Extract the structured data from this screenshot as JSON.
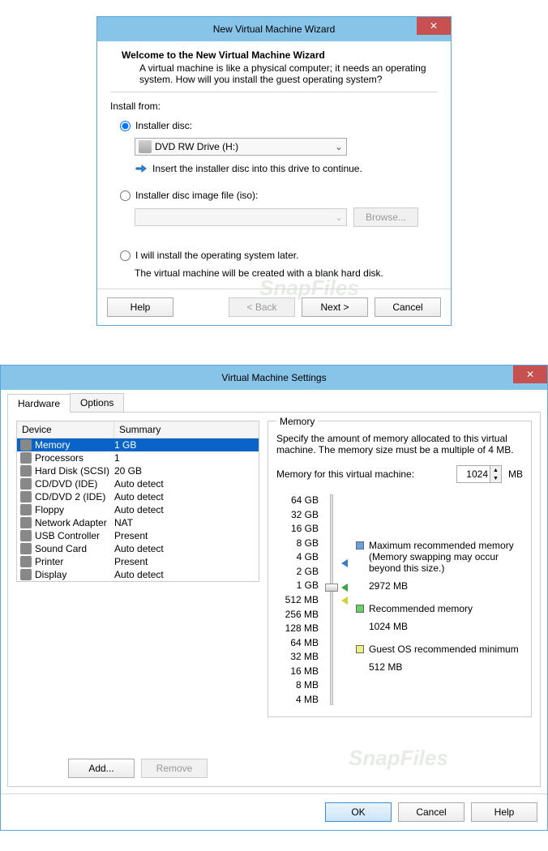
{
  "wizard": {
    "title": "New Virtual Machine Wizard",
    "heading": "Welcome to the New Virtual Machine Wizard",
    "description": "A virtual machine is like a physical computer; it needs an operating system. How will you install the guest operating system?",
    "install_from_label": "Install from:",
    "radio_disc_label": "Installer disc:",
    "drive_value": "DVD RW Drive (H:)",
    "hint_text": "Insert the installer disc into this drive to continue.",
    "radio_iso_label": "Installer disc image file (iso):",
    "browse_label": "Browse...",
    "radio_later_label": "I will install the operating system later.",
    "later_desc": "The virtual machine will be created with a blank hard disk.",
    "help_label": "Help",
    "back_label": "< Back",
    "next_label": "Next >",
    "cancel_label": "Cancel"
  },
  "settings": {
    "title": "Virtual Machine Settings",
    "tab_hardware": "Hardware",
    "tab_options": "Options",
    "col_device": "Device",
    "col_summary": "Summary",
    "devices": [
      {
        "name": "Memory",
        "summary": "1 GB",
        "selected": true
      },
      {
        "name": "Processors",
        "summary": "1"
      },
      {
        "name": "Hard Disk (SCSI)",
        "summary": "20 GB"
      },
      {
        "name": "CD/DVD (IDE)",
        "summary": "Auto detect"
      },
      {
        "name": "CD/DVD 2 (IDE)",
        "summary": "Auto detect"
      },
      {
        "name": "Floppy",
        "summary": "Auto detect"
      },
      {
        "name": "Network Adapter",
        "summary": "NAT"
      },
      {
        "name": "USB Controller",
        "summary": "Present"
      },
      {
        "name": "Sound Card",
        "summary": "Auto detect"
      },
      {
        "name": "Printer",
        "summary": "Present"
      },
      {
        "name": "Display",
        "summary": "Auto detect"
      }
    ],
    "add_label": "Add...",
    "remove_label": "Remove",
    "memory": {
      "legend": "Memory",
      "desc": "Specify the amount of memory allocated to this virtual machine. The memory size must be a multiple of 4 MB.",
      "value_label": "Memory for this virtual machine:",
      "value": "1024",
      "unit": "MB",
      "ticks": [
        "64 GB",
        "32 GB",
        "16 GB",
        "8 GB",
        "4 GB",
        "2 GB",
        "1 GB",
        "512 MB",
        "256 MB",
        "128 MB",
        "64 MB",
        "32 MB",
        "16 MB",
        "8 MB",
        "4 MB"
      ],
      "max_label": "Maximum recommended memory",
      "max_note": "(Memory swapping may occur beyond this size.)",
      "max_val": "2972 MB",
      "rec_label": "Recommended memory",
      "rec_val": "1024 MB",
      "min_label": "Guest OS recommended minimum",
      "min_val": "512 MB"
    },
    "ok_label": "OK",
    "cancel_label": "Cancel",
    "help_label": "Help"
  },
  "watermark": "SnapFiles"
}
